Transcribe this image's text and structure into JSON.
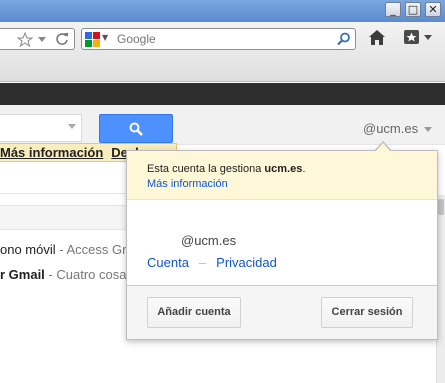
{
  "browser": {
    "window_buttons": [
      "_",
      "□",
      "✕"
    ],
    "search_placeholder": "Google",
    "icons": [
      "star-icon",
      "dropdown-icon",
      "reload-icon",
      "google-icon",
      "search-icon",
      "home-icon",
      "bookmarks-icon"
    ]
  },
  "gmail": {
    "account_short": "@ucm.es",
    "notice": {
      "more_info": "Más información",
      "undo": "Deshacer"
    },
    "rows": [
      {
        "from": "ono móvil",
        "sep": " - ",
        "snippet": "Access Gm"
      },
      {
        "from": "r Gmail",
        "sep": " - ",
        "snippet": "Cuatro cosa"
      }
    ]
  },
  "account_menu": {
    "managed_prefix": "Esta cuenta la gestiona ",
    "managed_domain": "ucm.es",
    "managed_suffix": ".",
    "more_info": "Más información",
    "email": "@ucm.es",
    "link_account": "Cuenta",
    "link_sep": "–",
    "link_privacy": "Privacidad",
    "add_account": "Añadir cuenta",
    "sign_out": "Cerrar sesión"
  },
  "colors": {
    "search_button": "#4d90fe",
    "notice_bg": "#f9edbe",
    "link": "#1155cc"
  }
}
